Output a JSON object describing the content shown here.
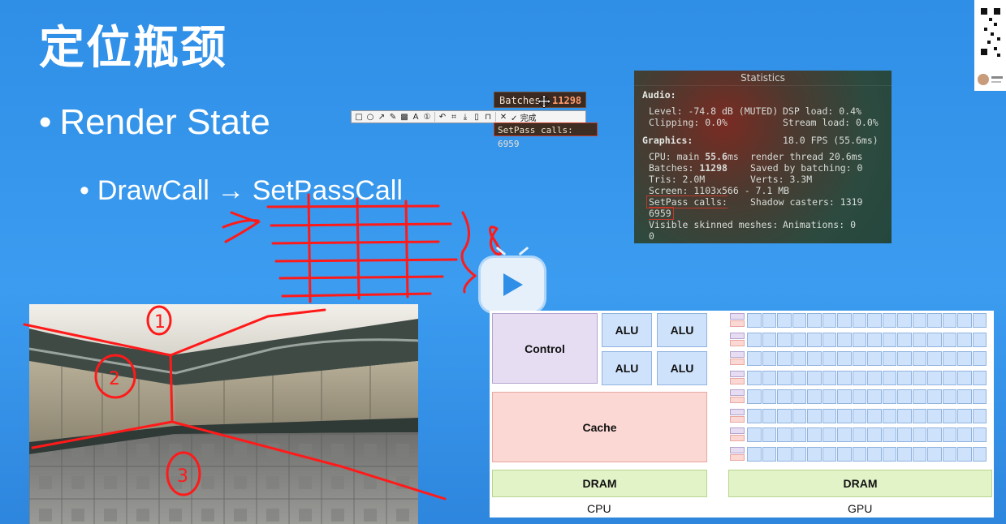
{
  "slide": {
    "title": "定位瓶颈",
    "bullet1": "Render State",
    "bullet2": "DrawCall → SetPassCall"
  },
  "toolbar": {
    "done_label": "完成"
  },
  "tooltip": {
    "batches_label": "Batches:",
    "batches_value": "11298",
    "setpass_text": "SetPass calls: 6959"
  },
  "statistics": {
    "header": "Statistics",
    "audio_label": "Audio:",
    "level": "Level: -74.8 dB (MUTED)",
    "dsp": "DSP load: 0.4%",
    "clipping": "Clipping: 0.0%",
    "stream": "Stream load: 0.0%",
    "graphics_label": "Graphics:",
    "fps": "18.0 FPS (55.6ms)",
    "cpu_prefix": "CPU: main ",
    "cpu_value": "55.6",
    "cpu_suffix": "ms",
    "render_thread": "render thread 20.6ms",
    "batches_prefix": "Batches: ",
    "batches_value": "11298",
    "saved_batching": "Saved by batching: 0",
    "tris": "Tris: 2.0M",
    "verts": "Verts: 3.3M",
    "screen": "Screen: 1103x566 - 7.1 MB",
    "setpass": "SetPass calls: 6959",
    "shadow": "Shadow casters: 1319",
    "skinned": "Visible skinned meshes: 0",
    "animations": "Animations: 0"
  },
  "diagram": {
    "control": "Control",
    "alu": "ALU",
    "cache": "Cache",
    "dram_cpu": "DRAM",
    "dram_gpu": "DRAM",
    "cpu_caption": "CPU",
    "gpu_caption": "GPU"
  },
  "colors": {
    "background": "#2f8ee6",
    "ink_red": "#ff1a1a",
    "control_fill": "#e6ddf3",
    "alu_fill": "#cfe2fb",
    "cache_fill": "#fbd8d4",
    "dram_fill": "#e3f3c8"
  },
  "annotations": {
    "n1": "1",
    "n2": "2",
    "n3": "3",
    "n8": "8"
  }
}
